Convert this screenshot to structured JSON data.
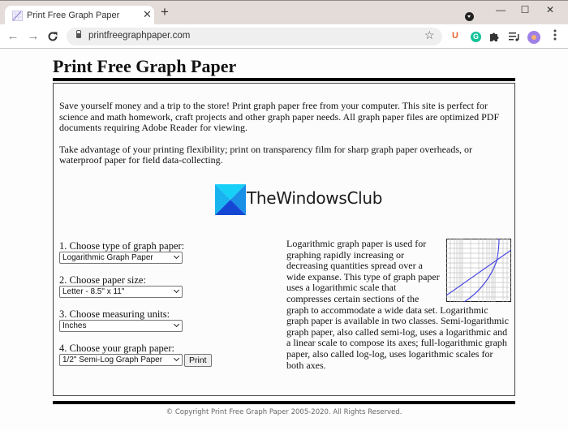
{
  "browser": {
    "tab": {
      "title": "Print Free Graph Paper",
      "close": "✕"
    },
    "new_tab": "+",
    "window_controls": {
      "minimize": "—",
      "maximize": "☐",
      "close": "✕"
    },
    "nav": {
      "back": "←",
      "forward": "→",
      "reload": "C"
    },
    "url": "printfreegraphpaper.com",
    "bookmark_star": "☆",
    "extensions": {
      "u_label": "U",
      "g_label": "G",
      "puzzle": "✱",
      "media": "≡♪",
      "menu": "⋮"
    }
  },
  "page": {
    "title": "Print Free Graph Paper",
    "intro": [
      "Save yourself money and a trip to the store! Print graph paper free from your computer. This site is perfect for science and math homework, craft projects and other graph paper needs. All graph paper files are optimized PDF documents requiring Adobe Reader for viewing.",
      "Take advantage of your printing flexibility; print on transparency film for sharp graph paper overheads, or waterproof paper for field data-collecting."
    ],
    "watermark": {
      "text": "TheWindowsClub"
    },
    "form": {
      "steps": [
        {
          "label": "1. Choose type of graph paper:",
          "value": "Logarithmic Graph Paper"
        },
        {
          "label": "2. Choose paper size:",
          "value": "Letter - 8.5\" x 11\""
        },
        {
          "label": "3. Choose measuring units:",
          "value": "Inches"
        },
        {
          "label": "4. Choose your graph paper:",
          "value": "1/2\" Semi-Log Graph Paper"
        }
      ],
      "print_label": "Print"
    },
    "description": "Logarithmic graph paper is used for graphing rapidly increasing or decreasing quantities spread over a wide expanse. This type of graph paper uses a logarithmic scale that compresses certain sections of the graph to accommodate a wide data set. Logarithmic graph paper is available in two classes. Semi-logarithmic graph paper, also called semi-log, uses a logarithmic and a linear scale to compose its axes; full-logarithmic graph paper, also called log-log, uses logarithmic scales for both axes.",
    "footer": "© Copyright Print Free Graph Paper 2005-2020. All Rights Reserved."
  },
  "colors": {
    "accent_blue": "#3b3bdb",
    "logo_light": "#18c6f5",
    "logo_dark": "#1652d8",
    "grammarly": "#15c39a",
    "ext_u": "#e8612c"
  }
}
